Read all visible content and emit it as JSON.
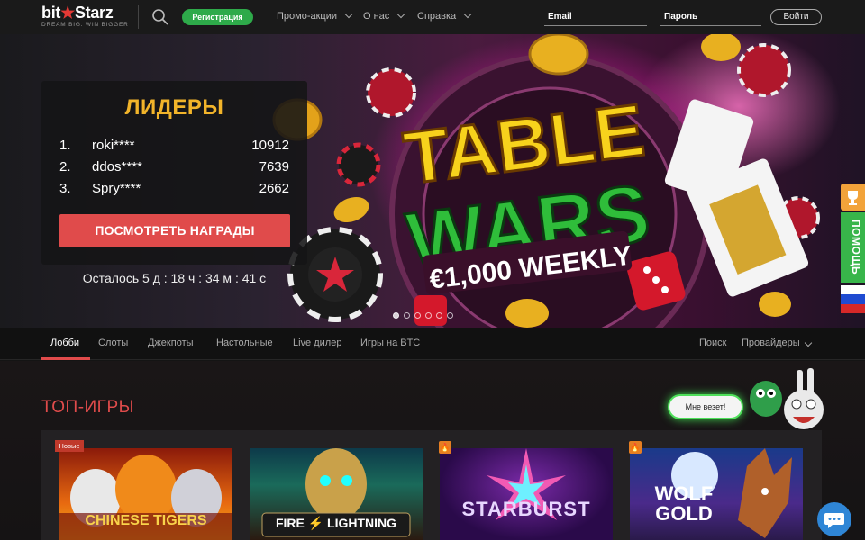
{
  "header": {
    "logo_main": "bit",
    "logo_star": "★",
    "logo_rest": "Starz",
    "logo_tagline": "DREAM BIG. WIN BIGGER",
    "register_label": "Регистрация",
    "nav": [
      {
        "label": "Промо-акции"
      },
      {
        "label": "О нас"
      },
      {
        "label": "Справка"
      }
    ],
    "email_placeholder": "Email",
    "password_placeholder": "Пароль",
    "login_label": "Войти"
  },
  "hero": {
    "leaders_title": "ЛИДЕРЫ",
    "leaders": [
      {
        "rank": "1.",
        "name": "roki****",
        "score": "10912"
      },
      {
        "rank": "2.",
        "name": "ddos****",
        "score": "7639"
      },
      {
        "rank": "3.",
        "name": "Spry****",
        "score": "2662"
      }
    ],
    "rewards_label": "ПОСМОТРЕТЬ НАГРАДЫ",
    "countdown": "Осталось 5 д : 18 ч : 34 м : 41 с",
    "banner_line1": "TABLE",
    "banner_line2": "WARS",
    "banner_line3": "€1,000 WEEKLY",
    "slides_total": 6,
    "slide_active": 1,
    "help_label": "ПОМОЩЬ"
  },
  "tabs": {
    "items": [
      {
        "label": "Лобби",
        "active": true
      },
      {
        "label": "Слоты"
      },
      {
        "label": "Джекпоты"
      },
      {
        "label": "Настольные"
      },
      {
        "label": "Live дилер"
      },
      {
        "label": "Игры на BTC"
      }
    ],
    "search_label": "Поиск",
    "providers_label": "Провайдеры"
  },
  "top_games": {
    "title": "ТОП-ИГРЫ",
    "lucky_label": "Мне везет!",
    "new_badge": "Новые",
    "games": [
      {
        "title": "CHINESE TIGERS",
        "badge": "new"
      },
      {
        "title": "FIRE ⚡ LIGHTNING",
        "badge": ""
      },
      {
        "title": "STARBURST",
        "badge": "hot"
      },
      {
        "title": "WOLF GOLD",
        "badge": "hot"
      }
    ]
  },
  "colors": {
    "accent_red": "#e04b4b",
    "gold": "#f2b42a",
    "green": "#2eaa4a",
    "help_green": "#38b54a",
    "chat_blue": "#2f86d6"
  }
}
